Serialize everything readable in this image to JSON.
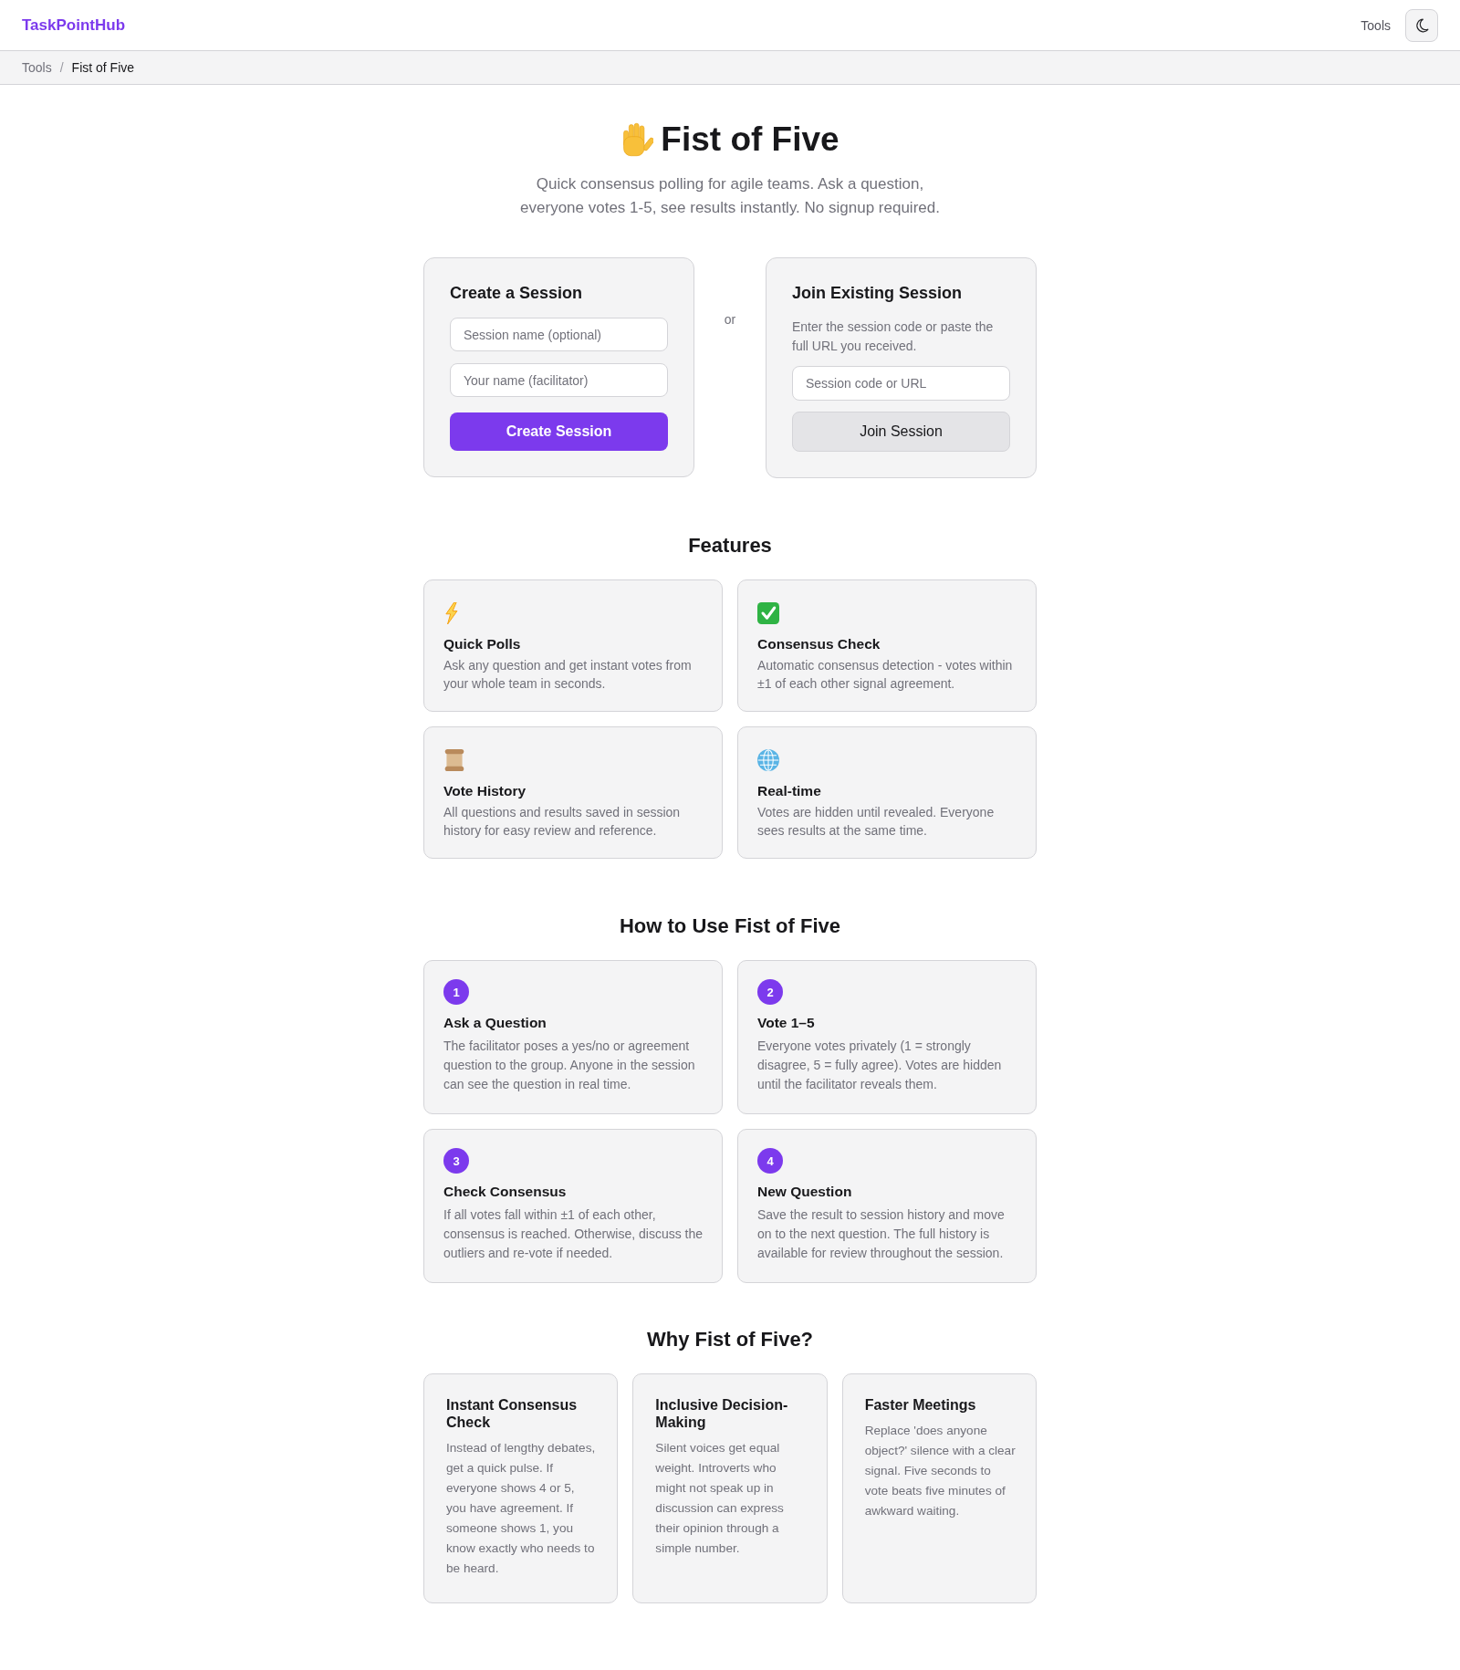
{
  "header": {
    "logo": "TaskPointHub",
    "nav": [
      {
        "label": "Tools"
      }
    ]
  },
  "breadcrumb": {
    "separator": "/",
    "items": [
      {
        "label": "Tools",
        "current": false
      },
      {
        "label": "Fist of Five",
        "current": true
      }
    ]
  },
  "hero": {
    "title": "Fist of Five",
    "subtitle": "Quick consensus polling for agile teams. Ask a question, everyone votes 1-5, see results instantly. No signup required."
  },
  "create_session": {
    "title": "Create a Session",
    "fields": [
      {
        "placeholder": "Session name (optional)"
      },
      {
        "placeholder": "Your name (facilitator)"
      }
    ],
    "button": "Create Session"
  },
  "divider": "or",
  "join_session": {
    "title": "Join Existing Session",
    "description": "Enter the session code or paste the full URL you received.",
    "field": {
      "placeholder": "Session code or URL"
    },
    "button": "Join Session"
  },
  "features": {
    "title": "Features",
    "items": [
      {
        "title": "Quick Polls",
        "description": "Ask any question and get instant votes from your whole team in seconds."
      },
      {
        "title": "Consensus Check",
        "description": "Automatic consensus detection - votes within ±1 of each other signal agreement."
      },
      {
        "title": "Vote History",
        "description": "All questions and results saved in session history for easy review and reference."
      },
      {
        "title": "Real-time",
        "description": "Votes are hidden until revealed. Everyone sees results at the same time."
      }
    ]
  },
  "how_to_use": {
    "title": "How to Use Fist of Five",
    "steps": [
      {
        "number": "1",
        "title": "Ask a Question",
        "description": "The facilitator poses a yes/no or agreement question to the group. Anyone in the session can see the question in real time."
      },
      {
        "number": "2",
        "title": "Vote 1–5",
        "description": "Everyone votes privately (1 = strongly disagree, 5 = fully agree). Votes are hidden until the facilitator reveals them."
      },
      {
        "number": "3",
        "title": "Check Consensus",
        "description": "If all votes fall within ±1 of each other, consensus is reached. Otherwise, discuss the outliers and re-vote if needed."
      },
      {
        "number": "4",
        "title": "New Question",
        "description": "Save the result to session history and move on to the next question. The full history is available for review throughout the session."
      }
    ]
  },
  "why": {
    "title": "Why Fist of Five?",
    "items": [
      {
        "title": "Instant Consensus Check",
        "description": "Instead of lengthy debates, get a quick pulse. If everyone shows 4 or 5, you have agreement. If someone shows 1, you know exactly who needs to be heard."
      },
      {
        "title": "Inclusive Decision-Making",
        "description": "Silent voices get equal weight. Introverts who might not speak up in discussion can express their opinion through a simple number."
      },
      {
        "title": "Faster Meetings",
        "description": "Replace 'does anyone object?' silence with a clear signal. Five seconds to vote beats five minutes of awkward waiting."
      }
    ]
  }
}
